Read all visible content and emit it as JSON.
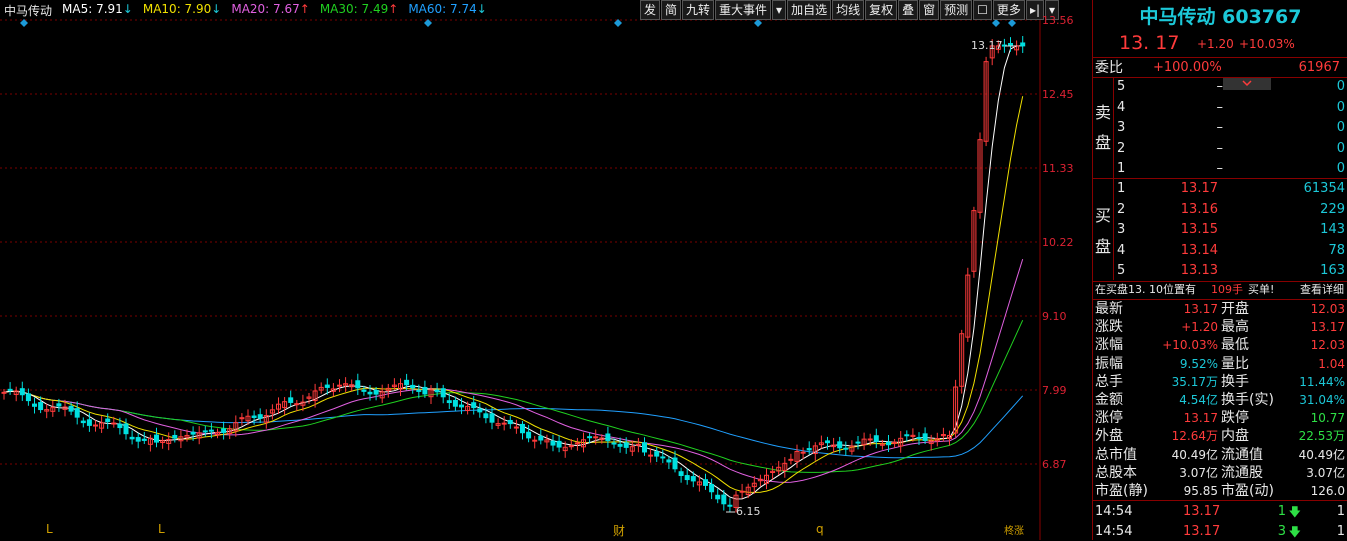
{
  "header": {
    "name": "中马传动",
    "ma5": "MA5: 7.91",
    "ma10": "MA10: 7.90",
    "ma20": "MA20: 7.67",
    "ma30": "MA30: 7.49",
    "ma60": "MA60: 7.74",
    "arrow_down": "↓",
    "arrow_up": "↑"
  },
  "toolbar": {
    "items": [
      "发",
      "简",
      "九转",
      "重大事件",
      "▾",
      "加自选",
      "均线",
      "复权",
      "叠",
      "窗",
      "预测",
      "☐",
      "更多",
      "▸|",
      "▾"
    ]
  },
  "chart": {
    "price_ticks": [
      "13.56",
      "12.45",
      "11.33",
      "10.22",
      "9.10",
      "7.99",
      "6.87"
    ],
    "high_label": "13.17",
    "low_label": "6.15",
    "bottom_markers": [
      "L",
      "L",
      "财",
      "q",
      "柊涨"
    ]
  },
  "colors": {
    "ma5": "#ffffff",
    "ma10": "#f0e000",
    "ma20": "#e060e0",
    "ma30": "#20d020",
    "ma60": "#20a0ff",
    "up": "#ff3b3b",
    "down": "#00e0e0"
  },
  "panel": {
    "title": "中马传动 603767",
    "price": "13. 17",
    "change": "+1.20",
    "pct": "+10.03%",
    "weibi_label": "委比",
    "weibi_pct": "+100.00%",
    "weibi_val": "61967",
    "sell_label_1": "卖",
    "sell_label_2": "盘",
    "buy_label_1": "买",
    "buy_label_2": "盘",
    "sells": [
      {
        "level": "5",
        "price": "–",
        "vol": "0"
      },
      {
        "level": "4",
        "price": "–",
        "vol": "0"
      },
      {
        "level": "3",
        "price": "–",
        "vol": "0"
      },
      {
        "level": "2",
        "price": "–",
        "vol": "0"
      },
      {
        "level": "1",
        "price": "–",
        "vol": "0"
      }
    ],
    "buys": [
      {
        "level": "1",
        "price": "13.17",
        "vol": "61354"
      },
      {
        "level": "2",
        "price": "13.16",
        "vol": "229"
      },
      {
        "level": "3",
        "price": "13.15",
        "vol": "143"
      },
      {
        "level": "4",
        "price": "13.14",
        "vol": "78"
      },
      {
        "level": "5",
        "price": "13.13",
        "vol": "163"
      }
    ],
    "notice_pre": "在买盘13. 10位置有",
    "notice_hand": "109手",
    "notice_post": "买单!",
    "notice_link": "查看详细",
    "stats": [
      [
        "最新",
        "13.17",
        "开盘",
        "12.03"
      ],
      [
        "涨跌",
        "+1.20",
        "最高",
        "13.17"
      ],
      [
        "涨幅",
        "+10.03%",
        "最低",
        "12.03"
      ],
      [
        "振幅",
        "9.52%",
        "量比",
        "1.04"
      ],
      [
        "总手",
        "35.17万",
        "换手",
        "11.44%"
      ],
      [
        "金额",
        "4.54亿",
        "换手(实)",
        "31.04%"
      ],
      [
        "涨停",
        "13.17",
        "跌停",
        "10.77"
      ],
      [
        "外盘",
        "12.64万",
        "内盘",
        "22.53万"
      ],
      [
        "总市值",
        "40.49亿",
        "流通值",
        "40.49亿"
      ],
      [
        "总股本",
        "3.07亿",
        "流通股",
        "3.07亿"
      ],
      [
        "市盈(静)",
        "95.85",
        "市盈(动)",
        "126.0"
      ]
    ],
    "ticks": [
      {
        "time": "14:54",
        "price": "13.17",
        "vol": "1",
        "n": "1"
      },
      {
        "time": "14:54",
        "price": "13.17",
        "vol": "3",
        "n": "1"
      }
    ]
  }
}
